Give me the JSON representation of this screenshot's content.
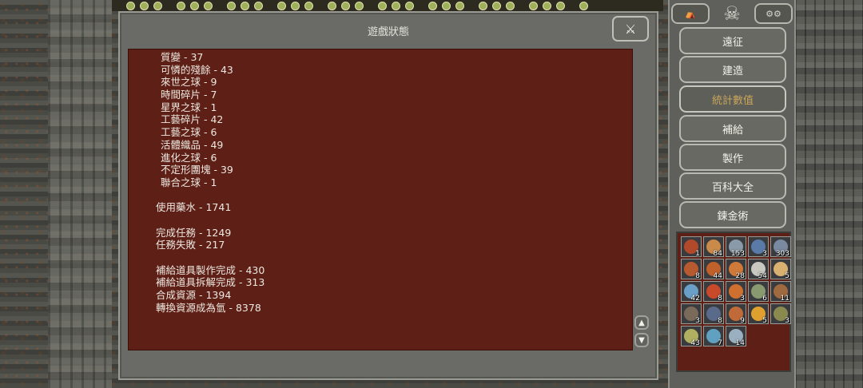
{
  "dialog": {
    "title": "遊戲狀態",
    "close_icon": "crossed-swords-icon",
    "stats": [
      {
        "text": "質變 - 37",
        "indent": true
      },
      {
        "text": "可憐的殘餘 - 43",
        "indent": true
      },
      {
        "text": "來世之球 - 9",
        "indent": true
      },
      {
        "text": "時間碎片 - 7",
        "indent": true
      },
      {
        "text": "星界之球 - 1",
        "indent": true
      },
      {
        "text": "工藝碎片 - 42",
        "indent": true
      },
      {
        "text": "工藝之球 - 6",
        "indent": true
      },
      {
        "text": "活體織品 - 49",
        "indent": true
      },
      {
        "text": "進化之球 - 6",
        "indent": true
      },
      {
        "text": "不定形團塊 - 39",
        "indent": true
      },
      {
        "text": "聯合之球 - 1",
        "indent": true
      },
      {
        "text": "",
        "indent": false
      },
      {
        "text": "使用藥水 - 1741",
        "indent": false
      },
      {
        "text": "",
        "indent": false
      },
      {
        "text": "完成任務 - 1249",
        "indent": false
      },
      {
        "text": "任務失敗 - 217",
        "indent": false
      },
      {
        "text": "",
        "indent": false
      },
      {
        "text": "補給道具製作完成 - 430",
        "indent": false
      },
      {
        "text": "補給道具拆解完成 - 313",
        "indent": false
      },
      {
        "text": "合成資源 - 1394",
        "indent": false
      },
      {
        "text": "轉換資源成為氫 - 8378",
        "indent": false
      }
    ]
  },
  "side_menu": {
    "top_left_icon": "camp-icon",
    "center_icon": "skull-icon",
    "top_right_icon": "settings-gears-icon",
    "buttons": [
      {
        "label": "遠征",
        "active": false
      },
      {
        "label": "建造",
        "active": false
      },
      {
        "label": "統計數值",
        "active": true
      },
      {
        "label": "補給",
        "active": false
      },
      {
        "label": "製作",
        "active": false
      },
      {
        "label": "百科大全",
        "active": false
      },
      {
        "label": "鍊金術",
        "active": false
      }
    ]
  },
  "inventory": {
    "items": [
      {
        "count": "1",
        "color": "#b04a2a",
        "icon": "spear-icon"
      },
      {
        "count": "84",
        "color": "#c98a4a",
        "icon": "bread-icon"
      },
      {
        "count": "153",
        "color": "#8a9aa8",
        "icon": "stone-icon"
      },
      {
        "count": "3",
        "color": "#5a7aa8",
        "icon": "dagger-icon"
      },
      {
        "count": "303",
        "color": "#7a8aa0",
        "icon": "metal-icon"
      },
      {
        "count": "8",
        "color": "#b85a30",
        "icon": "sword-icon"
      },
      {
        "count": "44",
        "color": "#c0602a",
        "icon": "meat-icon"
      },
      {
        "count": "28",
        "color": "#d07a3a",
        "icon": "orb-icon"
      },
      {
        "count": "54",
        "color": "#c8c8c0",
        "icon": "skull-icon"
      },
      {
        "count": "5",
        "color": "#d8b070",
        "icon": "scroll-icon"
      },
      {
        "count": "42",
        "color": "#6aa0c8",
        "icon": "eye-icon"
      },
      {
        "count": "8",
        "color": "#c84a2a",
        "icon": "horn-icon"
      },
      {
        "count": "3",
        "color": "#d07030",
        "icon": "flask-icon"
      },
      {
        "count": "6",
        "color": "#8a9a70",
        "icon": "sword-icon"
      },
      {
        "count": "11",
        "color": "#a06a40",
        "icon": "claw-icon"
      },
      {
        "count": "3",
        "color": "#7a6a5a",
        "icon": "ring-icon"
      },
      {
        "count": "8",
        "color": "#5a6a8a",
        "icon": "bomb-icon"
      },
      {
        "count": "9",
        "color": "#c06a3a",
        "icon": "pickaxe-icon"
      },
      {
        "count": "5",
        "color": "#e0a030",
        "icon": "orb-icon"
      },
      {
        "count": "3",
        "color": "#8a8a50",
        "icon": "shell-icon"
      },
      {
        "count": "43",
        "color": "#b0b060",
        "icon": "gear-icon"
      },
      {
        "count": "7",
        "color": "#60a0c0",
        "icon": "swirl-icon"
      },
      {
        "count": "14",
        "color": "#9ab0c0",
        "icon": "crystal-icon"
      }
    ]
  }
}
